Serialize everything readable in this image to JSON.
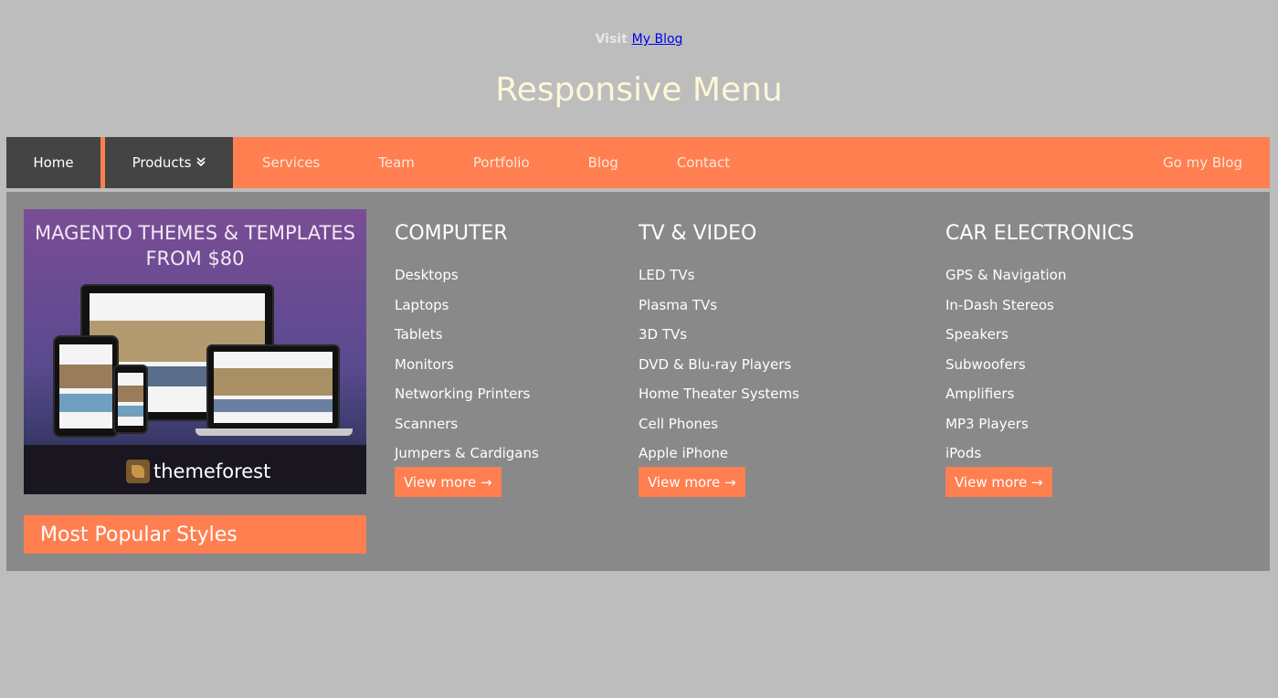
{
  "header": {
    "visit_prefix": "Visit",
    "visit_link": "My Blog",
    "title": "Responsive Menu"
  },
  "nav": {
    "home": "Home",
    "products": "Products",
    "products_chevron": "»",
    "items": [
      "Services",
      "Team",
      "Portfolio",
      "Blog",
      "Contact"
    ],
    "right": "Go my Blog"
  },
  "promo": {
    "line1": "MAGENTO THEMES & TEMPLATES",
    "line2": "FROM $80",
    "brand": "themeforest",
    "caption": "Most Popular Styles"
  },
  "columns": [
    {
      "title": "COMPUTER",
      "items": [
        "Desktops",
        "Laptops",
        "Tablets",
        "Monitors",
        "Networking Printers",
        "Scanners",
        "Jumpers & Cardigans"
      ],
      "more": "View more →"
    },
    {
      "title": "TV & VIDEO",
      "items": [
        "LED TVs",
        "Plasma TVs",
        "3D TVs",
        "DVD & Blu-ray Players",
        "Home Theater Systems",
        "Cell Phones",
        "Apple iPhone"
      ],
      "more": "View more →"
    },
    {
      "title": "CAR ELECTRONICS",
      "items": [
        "GPS & Navigation",
        "In-Dash Stereos",
        "Speakers",
        "Subwoofers",
        "Amplifiers",
        "MP3 Players",
        "iPods"
      ],
      "more": "View more →"
    }
  ],
  "colors": {
    "accent": "#ff7f50",
    "dark_tab": "#444444",
    "panel": "#898989",
    "page_bg": "#bdbdbd"
  }
}
